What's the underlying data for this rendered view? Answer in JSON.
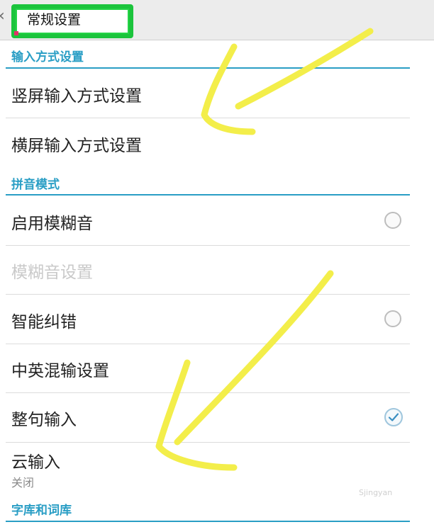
{
  "header": {
    "title": "常规设置"
  },
  "sections": {
    "input_method": "输入方式设置",
    "pinyin_mode": "拼音模式",
    "dictionary": "字库和词库"
  },
  "items": {
    "portrait_input": "竖屏输入方式设置",
    "landscape_input": "横屏输入方式设置",
    "fuzzy_enable": "启用模糊音",
    "fuzzy_settings": "模糊音设置",
    "smart_correct": "智能纠错",
    "mixed_input": "中英混输设置",
    "sentence_input": "整句输入",
    "cloud_input": "云输入",
    "cloud_input_status": "关闭"
  },
  "states": {
    "fuzzy_enable": false,
    "smart_correct": false,
    "sentence_input": true
  },
  "watermark": "Sjingyan",
  "colors": {
    "accent": "#2a9ec5",
    "annotation_yellow": "#f3ee4a",
    "annotation_green": "#1bc43c"
  }
}
